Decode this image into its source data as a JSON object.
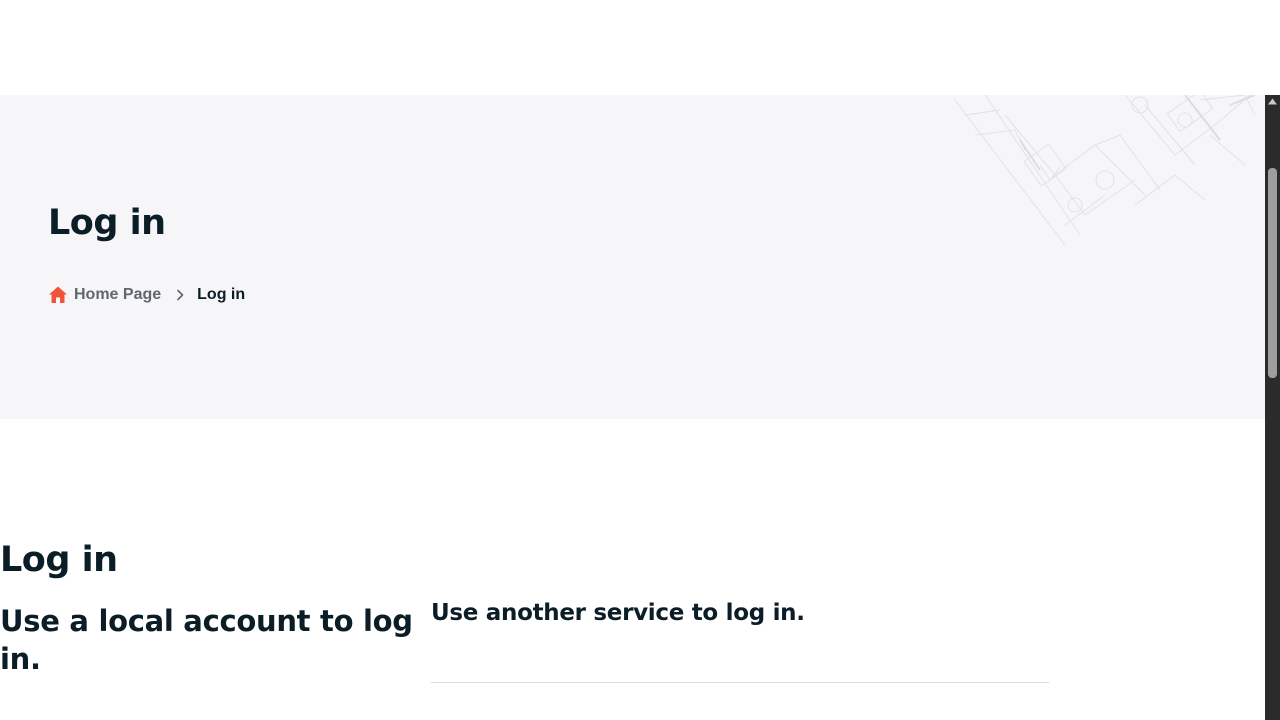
{
  "hero": {
    "title": "Log in",
    "breadcrumb": {
      "home_label": "Home Page",
      "current_label": "Log in",
      "home_icon": "home-icon",
      "separator_icon": "chevron-right-icon",
      "home_icon_color": "#f0553c"
    }
  },
  "main": {
    "title": "Log in",
    "local_account_heading": "Use a local account to log in.",
    "external_services_heading": "Use another service to log in."
  },
  "colors": {
    "hero_background": "#f6f6f8",
    "text_primary": "#0b1d26",
    "breadcrumb_link": "#5f6770",
    "accent": "#f0553c"
  }
}
